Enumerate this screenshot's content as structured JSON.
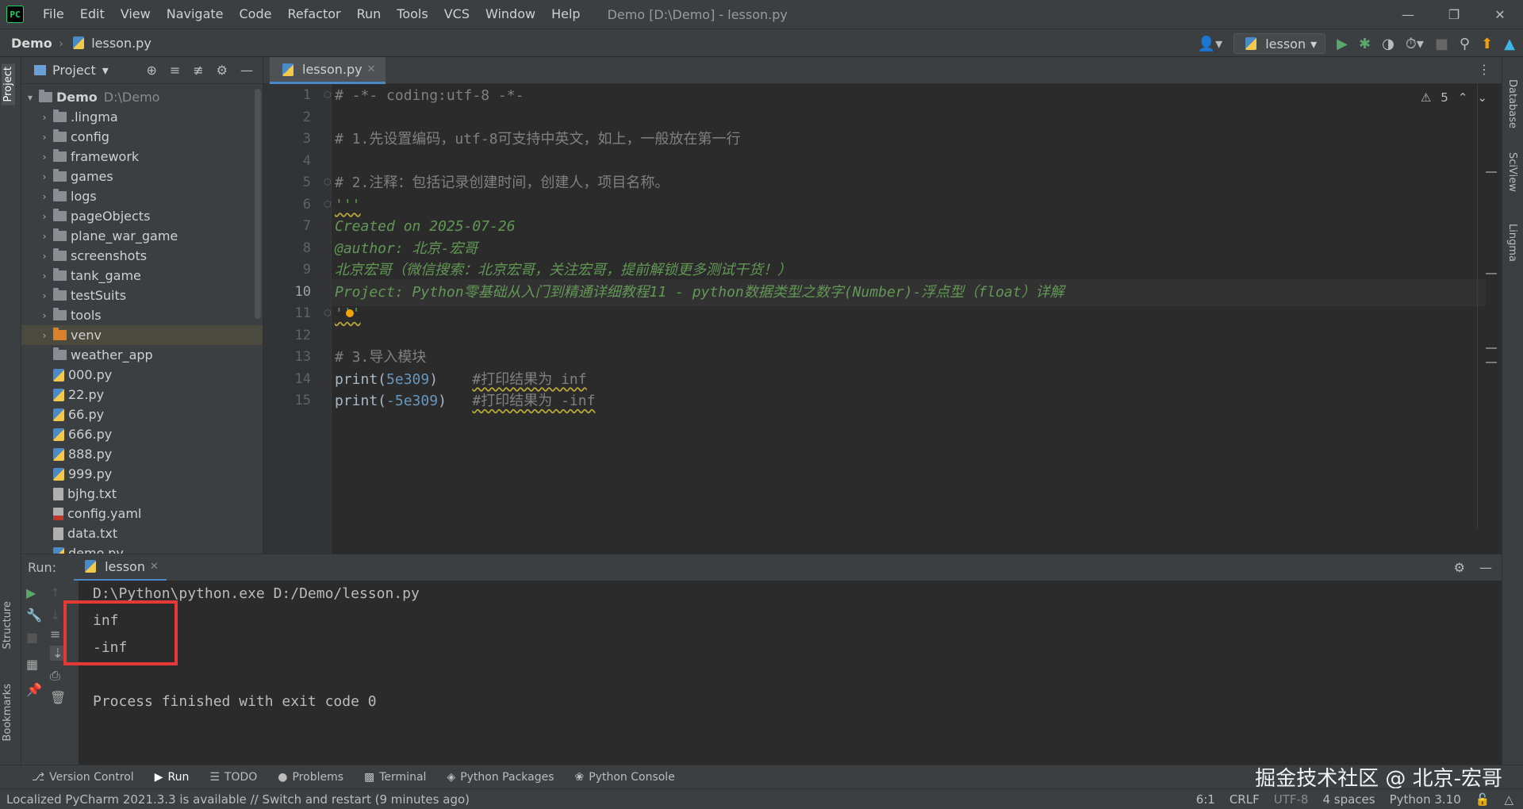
{
  "menu": [
    "File",
    "Edit",
    "View",
    "Navigate",
    "Code",
    "Refactor",
    "Run",
    "Tools",
    "VCS",
    "Window",
    "Help"
  ],
  "window_title": "Demo [D:\\Demo] - lesson.py",
  "breadcrumb": {
    "root": "Demo",
    "file": "lesson.py"
  },
  "run_config": "lesson",
  "project": {
    "title": "Project",
    "root_name": "Demo",
    "root_path": "D:\\Demo",
    "items": [
      {
        "name": ".lingma",
        "type": "folder"
      },
      {
        "name": "config",
        "type": "folder"
      },
      {
        "name": "framework",
        "type": "folder"
      },
      {
        "name": "games",
        "type": "folder"
      },
      {
        "name": "logs",
        "type": "folder"
      },
      {
        "name": "pageObjects",
        "type": "folder"
      },
      {
        "name": "plane_war_game",
        "type": "folder"
      },
      {
        "name": "screenshots",
        "type": "folder"
      },
      {
        "name": "tank_game",
        "type": "folder"
      },
      {
        "name": "testSuits",
        "type": "folder"
      },
      {
        "name": "tools",
        "type": "folder"
      },
      {
        "name": "venv",
        "type": "folder-excluded"
      },
      {
        "name": "weather_app",
        "type": "folder-noarrow"
      },
      {
        "name": "000.py",
        "type": "py"
      },
      {
        "name": "22.py",
        "type": "py"
      },
      {
        "name": "66.py",
        "type": "py"
      },
      {
        "name": "666.py",
        "type": "py"
      },
      {
        "name": "888.py",
        "type": "py"
      },
      {
        "name": "999.py",
        "type": "py"
      },
      {
        "name": "bjhg.txt",
        "type": "txt"
      },
      {
        "name": "config.yaml",
        "type": "yml"
      },
      {
        "name": "data.txt",
        "type": "txt"
      },
      {
        "name": "demo.py",
        "type": "py"
      }
    ]
  },
  "editor": {
    "tab": "lesson.py",
    "warnings": "5",
    "current_line": 10,
    "lines": [
      "# -*- coding:utf-8 -*-",
      "",
      "# 1.先设置编码，utf-8可支持中英文，如上，一般放在第一行",
      "",
      "# 2.注释：包括记录创建时间，创建人，项目名称。",
      "'''",
      "Created on 2025-07-26",
      "@author: 北京-宏哥",
      "北京宏哥（微信搜索：北京宏哥，关注宏哥，提前解锁更多测试干货！）",
      "Project: Python零基础从入门到精通详细教程11 - python数据类型之数字(Number)-浮点型（float）详解",
      "'''",
      "",
      "# 3.导入模块",
      "print(5e309)",
      "print(-5e309)"
    ],
    "line14": {
      "fn": "print(",
      "num": "5e309",
      "close": ")",
      "comment": "#打印结果为 inf"
    },
    "line15": {
      "fn": "print(",
      "num": "-5e309",
      "close": ")",
      "comment": "#打印结果为 -inf"
    }
  },
  "run": {
    "label": "Run:",
    "tab": "lesson",
    "output": [
      "D:\\Python\\python.exe D:/Demo/lesson.py",
      "inf",
      "-inf",
      "",
      "Process finished with exit code 0"
    ]
  },
  "tool_windows": [
    "Version Control",
    "Run",
    "TODO",
    "Problems",
    "Terminal",
    "Python Packages",
    "Python Console"
  ],
  "left_tabs": [
    "Project",
    "Structure",
    "Bookmarks"
  ],
  "right_tabs": [
    "Database",
    "SciView",
    "Lingma"
  ],
  "watermark": "掘金技术社区 @ 北京-宏哥",
  "status": {
    "message": "Localized PyCharm 2021.3.3 is available // Switch and restart (9 minutes ago)",
    "position": "6:1",
    "line_sep": "CRLF",
    "encoding": "UTF-8",
    "indent": "4 spaces",
    "interpreter": "Python 3.10"
  },
  "colors": {
    "accent": "#4a88c7",
    "highlight_box": "#e53935",
    "docstring": "#629755",
    "number": "#6897bb"
  }
}
